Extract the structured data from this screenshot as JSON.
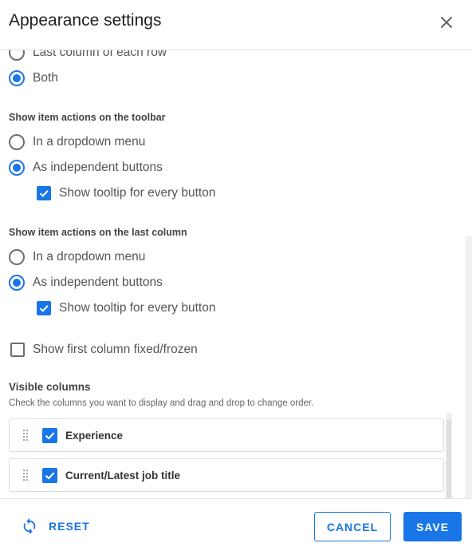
{
  "header": {
    "title": "Appearance settings",
    "close_icon": "close-icon"
  },
  "highlight_group": {
    "options": [
      {
        "label": "Last column of each row",
        "selected": false
      },
      {
        "label": "Both",
        "selected": true
      }
    ]
  },
  "toolbar_actions": {
    "title": "Show item actions on the toolbar",
    "options": [
      {
        "label": "In a dropdown menu",
        "selected": false
      },
      {
        "label": "As independent buttons",
        "selected": true
      }
    ],
    "tooltip_label": "Show tooltip for every button",
    "tooltip_checked": true
  },
  "last_column_actions": {
    "title": "Show item actions on the last column",
    "options": [
      {
        "label": "In a dropdown menu",
        "selected": false
      },
      {
        "label": "As independent buttons",
        "selected": true
      }
    ],
    "tooltip_label": "Show tooltip for every button",
    "tooltip_checked": true
  },
  "first_column_fixed": {
    "label": "Show first column fixed/frozen",
    "checked": false
  },
  "visible_columns": {
    "title": "Visible columns",
    "hint": "Check the columns you want to display and drag and drop to change order.",
    "items": [
      {
        "label": "Experience",
        "checked": true
      },
      {
        "label": "Current/Latest job title",
        "checked": true
      }
    ]
  },
  "footer": {
    "reset_label": "RESET",
    "cancel_label": "CANCEL",
    "save_label": "SAVE"
  },
  "colors": {
    "accent": "#1976e8",
    "text": "#555555",
    "border": "#dcdcdc"
  }
}
